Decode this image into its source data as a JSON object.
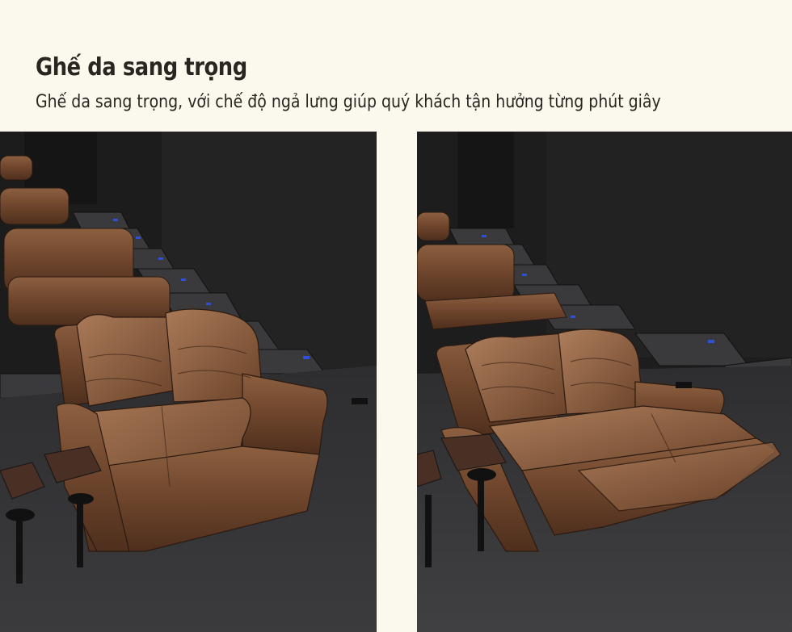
{
  "header": {
    "title": "Ghế da sang trọng",
    "subtitle": "Ghế da sang trọng, với chế độ ngả lưng giúp quý khách tận hưởng từng phút giây"
  },
  "photos": [
    {
      "content": "leather-loveseat-upright"
    },
    {
      "content": "leather-loveseat-reclined"
    }
  ],
  "colors": {
    "background": "#fbf9ee",
    "text": "#2a2520",
    "leather": "#7a4f33",
    "wall": "#1e1e1f",
    "step_light": "#2f4fd8"
  }
}
